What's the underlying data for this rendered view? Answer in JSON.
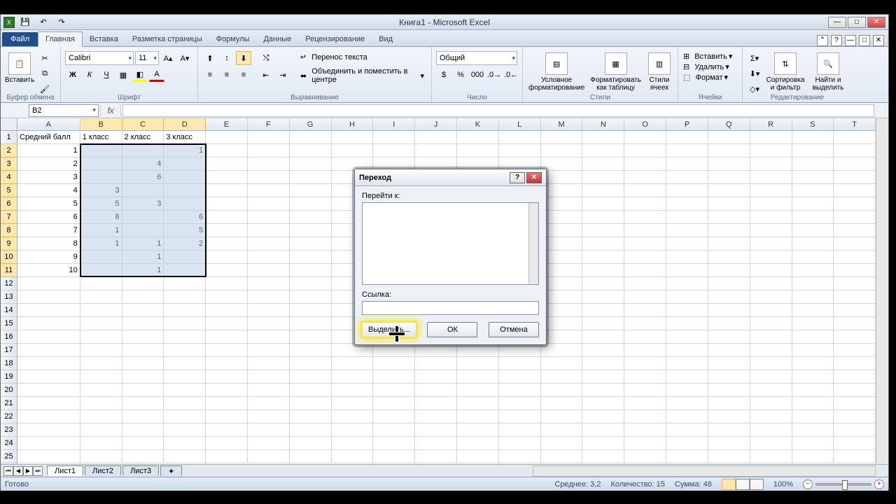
{
  "title": "Книга1 - Microsoft Excel",
  "tabs": {
    "file": "Файл",
    "list": [
      "Главная",
      "Вставка",
      "Разметка страницы",
      "Формулы",
      "Данные",
      "Рецензирование",
      "Вид"
    ],
    "active": 0
  },
  "ribbon": {
    "clipboard": {
      "label": "Буфер обмена",
      "paste": "Вставить"
    },
    "font": {
      "label": "Шрифт",
      "name": "Calibri",
      "size": "11"
    },
    "align": {
      "label": "Выравнивание",
      "wrap": "Перенос текста",
      "merge": "Объединить и поместить в центре"
    },
    "number": {
      "label": "Число",
      "format": "Общий"
    },
    "styles": {
      "label": "Стили",
      "cond": "Условное форматирование",
      "table": "Форматировать как таблицу",
      "cell": "Стили ячеек"
    },
    "cells": {
      "label": "Ячейки",
      "insert": "Вставить",
      "delete": "Удалить",
      "format": "Формат"
    },
    "editing": {
      "label": "Редактирование",
      "sort": "Сортировка и фильтр",
      "find": "Найти и выделить"
    }
  },
  "namebox": "B2",
  "columns": [
    "A",
    "B",
    "C",
    "D",
    "E",
    "F",
    "G",
    "H",
    "I",
    "J",
    "K",
    "L",
    "M",
    "N",
    "O",
    "P",
    "Q",
    "R",
    "S",
    "T"
  ],
  "rows": 25,
  "data": {
    "A1": "Средний балл",
    "B1": "1 класс",
    "C1": "2 класс",
    "D1": "3 класс",
    "A2": "1",
    "D2": "1",
    "A3": "2",
    "C3": "4",
    "A4": "3",
    "C4": "6",
    "A5": "4",
    "B5": "3",
    "A6": "5",
    "B6": "5",
    "C6": "3",
    "A7": "6",
    "B7": "8",
    "D7": "6",
    "A8": "7",
    "B8": "1",
    "D8": "5",
    "A9": "8",
    "B9": "1",
    "C9": "1",
    "D9": "2",
    "A10": "9",
    "C10": "1",
    "A11": "10",
    "C11": "1"
  },
  "selection": {
    "ref": "B2:D11"
  },
  "sheets": [
    "Лист1",
    "Лист2",
    "Лист3"
  ],
  "status": {
    "ready": "Готово",
    "avg_l": "Среднее:",
    "avg_v": "3,2",
    "cnt_l": "Количество:",
    "cnt_v": "15",
    "sum_l": "Сумма:",
    "sum_v": "48",
    "zoom": "100%"
  },
  "dialog": {
    "title": "Переход",
    "goto_label": "Перейти к:",
    "ref_label": "Ссылка:",
    "ref_value": "",
    "special": "Выделить...",
    "ok": "ОК",
    "cancel": "Отмена"
  }
}
